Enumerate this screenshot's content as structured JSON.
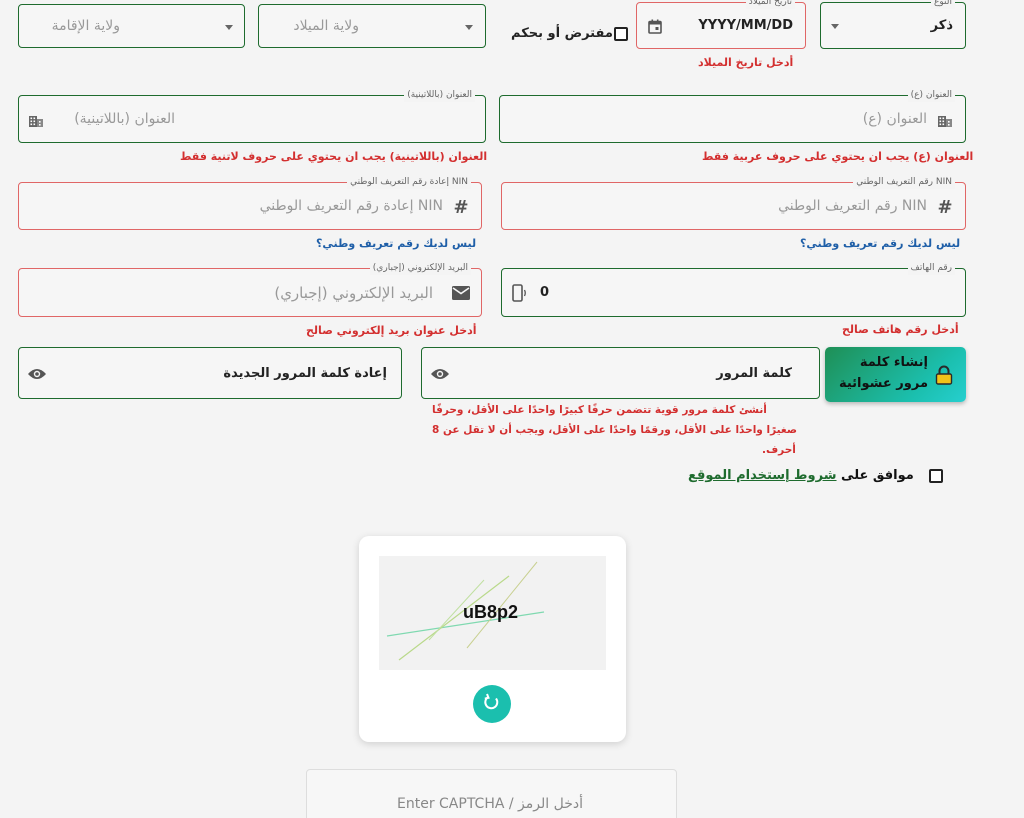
{
  "residence_wilaya": {
    "placeholder": "ولاية الإقامة"
  },
  "birth_wilaya": {
    "placeholder": "ولاية الميلاد"
  },
  "presumed": {
    "label": "مفترض أو بحكم"
  },
  "birth_date": {
    "label": "تاريخ الميلاد",
    "value": "YYYY/MM/DD",
    "error": "أدخل تاريخ الميلاد"
  },
  "gender": {
    "label": "النوع",
    "value": "ذكر"
  },
  "address_latin": {
    "label": "العنوان (باللاتينية)",
    "placeholder": "العنوان (باللاتينية)",
    "error": "العنوان (باللاتينية) يجب ان يحتوي على حروف لاتنية فقط"
  },
  "address_ar": {
    "label": "العنوان (ع)",
    "placeholder": "العنوان (ع)",
    "error": "العنوان (ع) يجب ان يحتوي على حروف عربية فقط"
  },
  "nin_confirm": {
    "label": "إعادة رقم التعريف الوطني NIN",
    "placeholder": "إعادة رقم التعريف الوطني NIN",
    "link": "ليس لديك رقم تعريف وطني؟"
  },
  "nin": {
    "label": "رقم التعريف الوطني NIN",
    "placeholder": "رقم التعريف الوطني NIN",
    "link": "ليس لديك رقم تعريف وطني؟"
  },
  "email": {
    "label": "البريد الإلكتروني (إجباري)",
    "placeholder": "البريد الإلكتروني (إجباري)",
    "error": "أدخل عنوان بريد إلكتروني صالح"
  },
  "phone": {
    "label": "رقم الهاتف",
    "value": "0",
    "error": "أدخل رقم هاتف صالح"
  },
  "password_confirm": {
    "placeholder": "إعادة كلمة المرور الجديدة"
  },
  "password": {
    "placeholder": "كلمة المرور",
    "hint_1": "أنشئ كلمة مرور قوية تتضمن حرفًا كبيرًا واحدًا على الأقل، وحرفًا",
    "hint_2": "صغيرًا واحدًا على الأقل، ورقمًا واحدًا على الأقل، ويجب أن لا تقل عن 8",
    "hint_3": "أحرف."
  },
  "generate_password": {
    "line1": "إنشاء كلمة",
    "line2": "مرور عشوائية"
  },
  "terms": {
    "prefix": "موافق على ",
    "link": "شروط إستخدام الموقع"
  },
  "captcha": {
    "text": "uB8p2",
    "input_placeholder": "أدخل الرمز / Enter CAPTCHA"
  },
  "colors": {
    "accent": "#1e6b2e",
    "error": "#d32f2f",
    "teal": "#1bbfae",
    "link": "#1f5fa8"
  }
}
